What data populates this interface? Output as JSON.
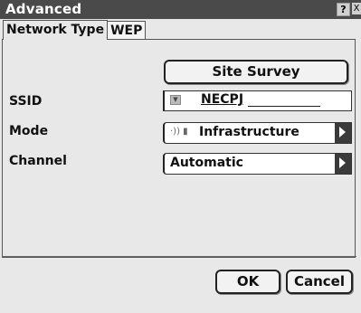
{
  "window": {
    "title": "Advanced",
    "help_glyph": "?",
    "close_glyph": "X"
  },
  "tabs": [
    {
      "label": "Network Type"
    },
    {
      "label": "WEP"
    }
  ],
  "form": {
    "site_survey_label": "Site Survey",
    "ssid_label": "SSID",
    "ssid_value": "NECPJ",
    "mode_label": "Mode",
    "mode_value": "Infrastructure",
    "mode_icons": "·)) ▮",
    "channel_label": "Channel",
    "channel_value": "Automatic"
  },
  "footer": {
    "ok_label": "OK",
    "cancel_label": "Cancel"
  }
}
